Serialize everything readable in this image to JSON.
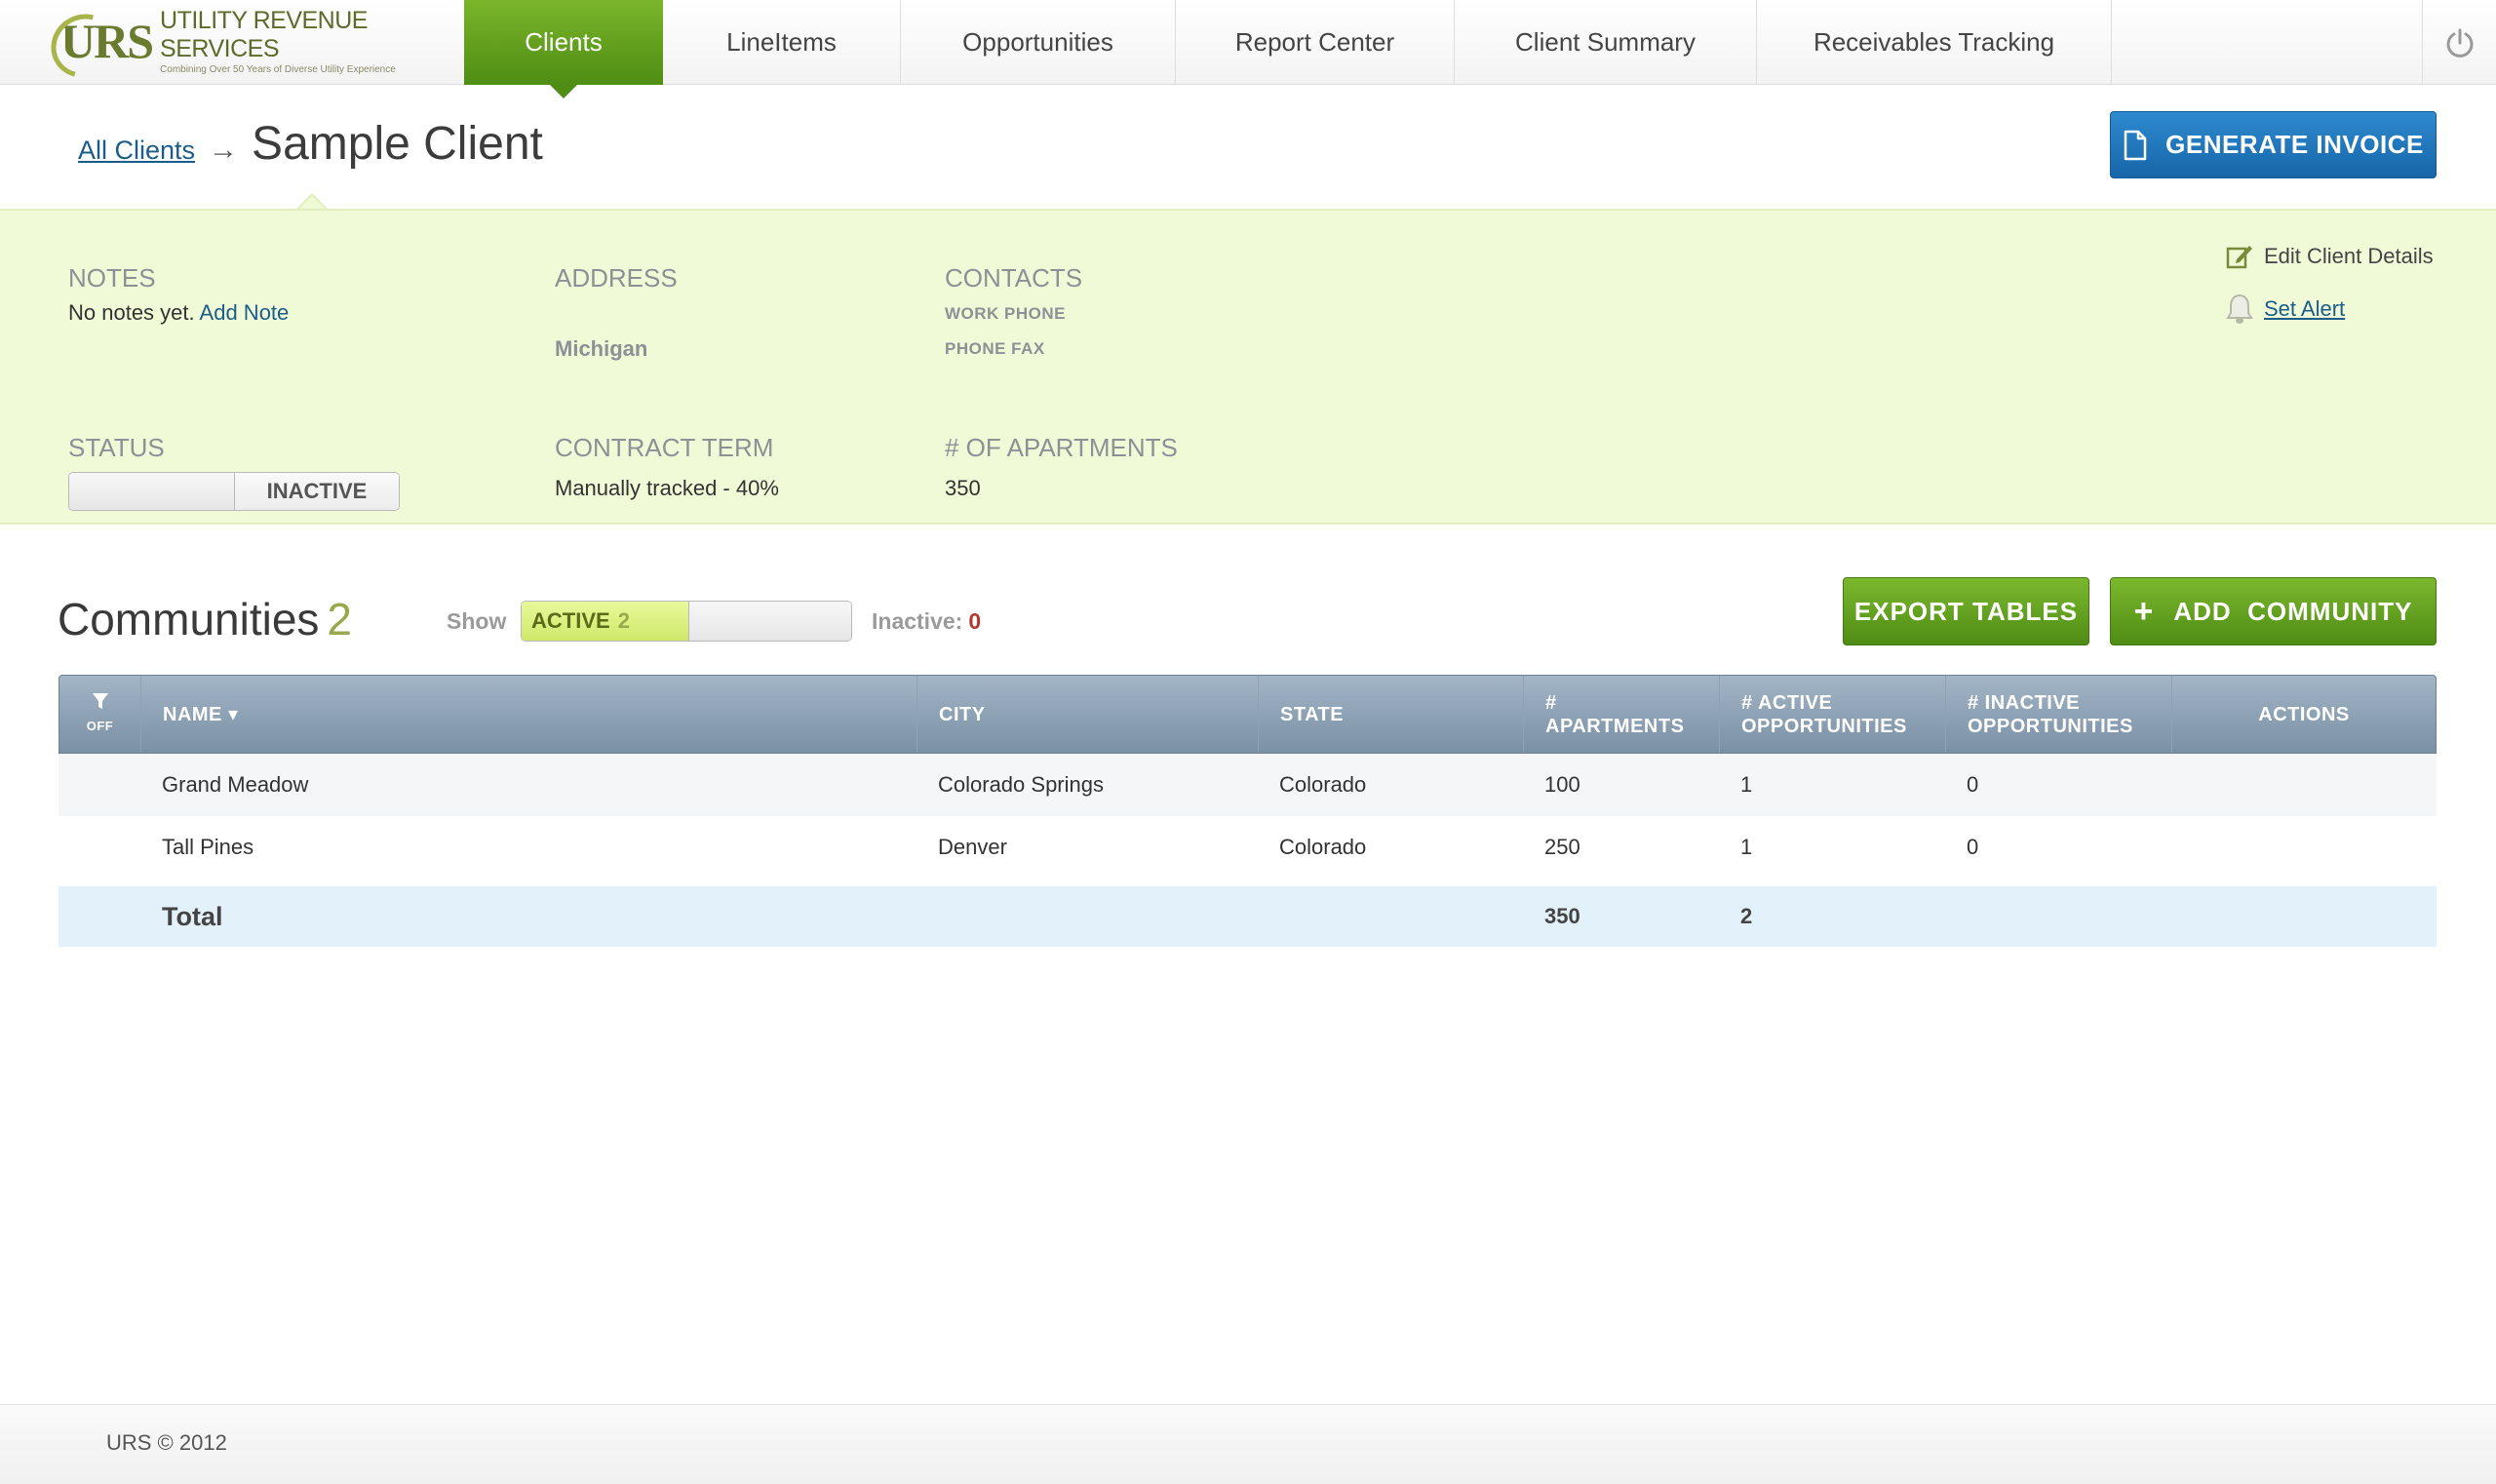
{
  "brand": {
    "logo_mark": "URS",
    "name": "UTILITY REVENUE SERVICES",
    "tagline": "Combining Over 50 Years of Diverse Utility Experience"
  },
  "nav": {
    "tabs": [
      {
        "label": "Clients",
        "active": true
      },
      {
        "label": "LineItems",
        "active": false
      },
      {
        "label": "Opportunities",
        "active": false
      },
      {
        "label": "Report Center",
        "active": false
      },
      {
        "label": "Client Summary",
        "active": false
      },
      {
        "label": "Receivables Tracking",
        "active": false
      }
    ]
  },
  "header": {
    "breadcrumb_link": "All Clients",
    "breadcrumb_arrow": "→",
    "title": "Sample Client",
    "generate_invoice_label": "GENERATE INVOICE"
  },
  "details": {
    "notes_label": "NOTES",
    "notes_text": "No notes yet.",
    "add_note_label": "Add Note",
    "address_label": "ADDRESS",
    "address_value": "Michigan",
    "contacts_label": "CONTACTS",
    "work_phone_label": "WORK PHONE",
    "phone_fax_label": "PHONE FAX",
    "status_label": "STATUS",
    "status_value": "INACTIVE",
    "contract_term_label": "CONTRACT TERM",
    "contract_term_value": "Manually tracked - 40%",
    "apartments_label": "# OF APARTMENTS",
    "apartments_value": "350",
    "edit_details_label": "Edit Client Details",
    "set_alert_label": "Set Alert"
  },
  "communities": {
    "title": "Communities",
    "count": "2",
    "show_label": "Show",
    "active_label": "ACTIVE",
    "active_count": "2",
    "inactive_label": "Inactive:",
    "inactive_count": "0",
    "export_label": "EXPORT TABLES",
    "add_label": "ADD  COMMUNITY",
    "add_plus": "+"
  },
  "table": {
    "filter_label": "OFF",
    "columns": {
      "name": "NAME ▾",
      "city": "CITY",
      "state": "STATE",
      "apartments_line1": "#",
      "apartments_line2": "APARTMENTS",
      "active_line1": "# ACTIVE",
      "active_line2": "OPPORTUNITIES",
      "inactive_line1": "# INACTIVE",
      "inactive_line2": "OPPORTUNITIES",
      "actions": "ACTIONS"
    },
    "rows": [
      {
        "name": "Grand Meadow",
        "city": "Colorado Springs",
        "state": "Colorado",
        "apartments": "100",
        "active": "1",
        "inactive": "0"
      },
      {
        "name": "Tall Pines",
        "city": "Denver",
        "state": "Colorado",
        "apartments": "250",
        "active": "1",
        "inactive": "0"
      }
    ],
    "total": {
      "label": "Total",
      "apartments": "350",
      "active": "2"
    }
  },
  "footer": {
    "text": "URS © 2012"
  },
  "colors": {
    "brand_green": "#5a9a1c",
    "primary_blue": "#1f75bd",
    "panel_bg": "#f1fad7",
    "header_slate": "#8a9eb2"
  }
}
